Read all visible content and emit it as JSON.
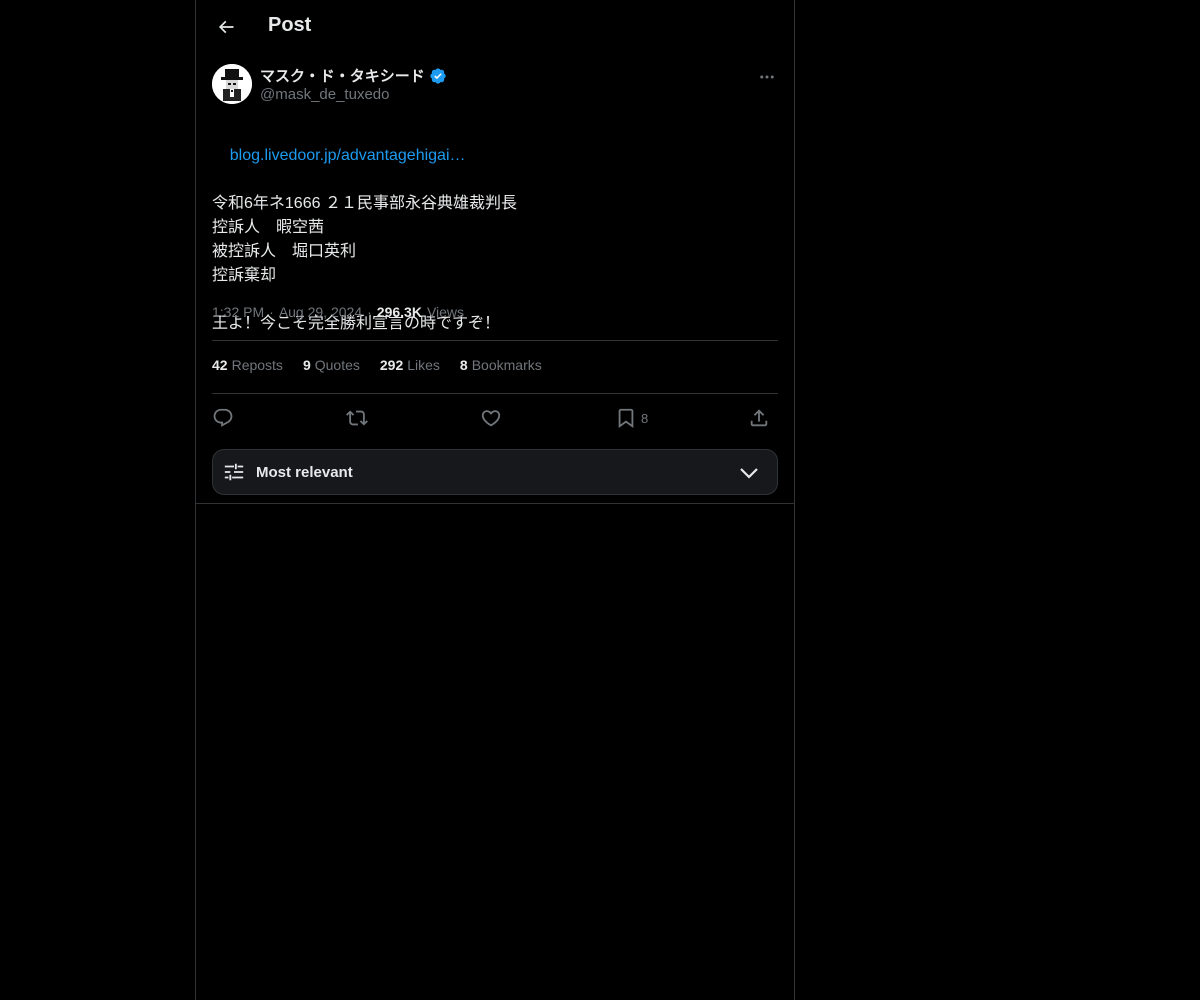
{
  "header": {
    "title": "Post"
  },
  "author": {
    "display_name": "マスク・ド・タキシード",
    "handle": "@mask_de_tuxedo",
    "verified": true,
    "verified_color": "#1d9bf0"
  },
  "tweet": {
    "link": "blog.livedoor.jp/advantagehigai…",
    "body": "令和6年ネ1666 ２１民事部永谷典雄裁判長\n控訴人　暇空茜\n被控訴人　堀口英利\n控訴棄却\n\n王よ！今こそ完全勝利宣言の時ですぞ！",
    "time": "1:32 PM",
    "date": "Aug 29, 2024",
    "views_count": "296.3K",
    "views_label": "Views"
  },
  "stats": {
    "reposts_count": "42",
    "reposts_label": "Reposts",
    "quotes_count": "9",
    "quotes_label": "Quotes",
    "likes_count": "292",
    "likes_label": "Likes",
    "bookmarks_count": "8",
    "bookmarks_label": "Bookmarks"
  },
  "actions": {
    "bookmark_count": "8"
  },
  "sort": {
    "label": "Most relevant"
  },
  "colors": {
    "background": "#000000",
    "text": "#e7e9ea",
    "muted": "#71767b",
    "accent": "#1d9bf0",
    "border": "#2f3336"
  }
}
